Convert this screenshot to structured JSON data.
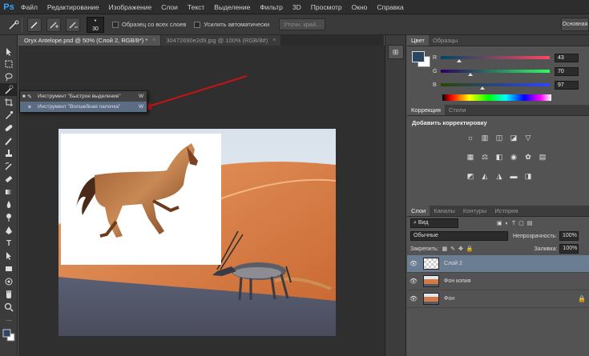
{
  "app": {
    "logo": "Ps"
  },
  "menu": [
    "Файл",
    "Редактирование",
    "Изображение",
    "Слои",
    "Текст",
    "Выделение",
    "Фильтр",
    "3D",
    "Просмотр",
    "Окно",
    "Справка"
  ],
  "options": {
    "brush_size": "30",
    "sample_all_layers": "Образец со всех слоев",
    "auto_enhance": "Усилить автоматически",
    "refine_edge": "Уточн. край...",
    "workspace": "Основная"
  },
  "doc_tabs": [
    {
      "title": "Oryx Antelope.psd @ 50% (Слой 2, RGB/8*) *",
      "close": "×"
    },
    {
      "title": "30472690e2d9.jpg @ 100% (RGB/8#)",
      "close": "×"
    }
  ],
  "flyout": {
    "items": [
      {
        "bullet": "■",
        "label": "Инструмент \"Быстрое выделение\"",
        "key": "W"
      },
      {
        "bullet": "",
        "label": "Инструмент \"Волшебная палочка\"",
        "key": "W"
      }
    ]
  },
  "color_panel": {
    "tabs": [
      "Цвет",
      "Образцы"
    ],
    "fg_color": "#2b4661",
    "channels": [
      {
        "name": "R",
        "value": "43",
        "level": 0.17
      },
      {
        "name": "G",
        "value": "70",
        "level": 0.27
      },
      {
        "name": "B",
        "value": "97",
        "level": 0.38
      }
    ]
  },
  "adjustments": {
    "tabs": [
      "Коррекция",
      "Стили"
    ],
    "title": "Добавить корректировку"
  },
  "layers_panel": {
    "tabs": [
      "Слои",
      "Каналы",
      "Контуры",
      "История"
    ],
    "filter": "Вид",
    "blend_mode": "Обычные",
    "opacity_label": "Непрозрачность:",
    "opacity": "100%",
    "lock_label": "Закрепить:",
    "fill_label": "Заливка:",
    "fill": "100%",
    "layers": [
      {
        "name": "Слой 2",
        "selected": true
      },
      {
        "name": "Фон копия",
        "selected": false
      },
      {
        "name": "Фон",
        "selected": false
      }
    ]
  }
}
